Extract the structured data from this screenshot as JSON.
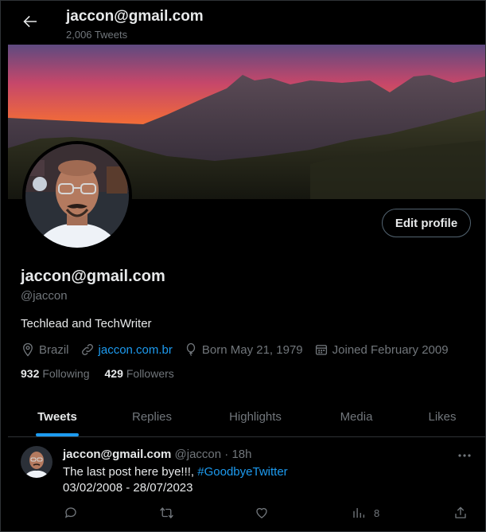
{
  "header": {
    "title": "jaccon@gmail.com",
    "tweet_count": "2,006 Tweets"
  },
  "profile": {
    "edit_label": "Edit profile",
    "name": "jaccon@gmail.com",
    "handle": "@jaccon",
    "bio": "Techlead and TechWriter",
    "location": "Brazil",
    "website": "jaccon.com.br",
    "born": "Born May 21, 1979",
    "joined": "Joined February 2009",
    "following_count": "932",
    "following_label": "Following",
    "followers_count": "429",
    "followers_label": "Followers"
  },
  "tabs": [
    {
      "label": "Tweets",
      "active": true
    },
    {
      "label": "Replies",
      "active": false
    },
    {
      "label": "Highlights",
      "active": false
    },
    {
      "label": "Media",
      "active": false
    },
    {
      "label": "Likes",
      "active": false
    }
  ],
  "tweet": {
    "name": "jaccon@gmail.com",
    "handle": "@jaccon",
    "separator": "·",
    "time": "18h",
    "text": "The last post here bye!!!, ",
    "hashtag": "#GoodbyeTwitter",
    "line2": "03/02/2008 - 28/07/2023",
    "views": "8"
  },
  "colors": {
    "background": "#000000",
    "accent": "#1d9bf0",
    "primary_text": "#e7e9ea",
    "secondary_text": "#71767b"
  },
  "icons": [
    "arrow-left-icon",
    "location-icon",
    "link-icon",
    "balloon-icon",
    "calendar-icon",
    "more-icon",
    "reply-icon",
    "retweet-icon",
    "like-icon",
    "views-icon",
    "share-icon"
  ]
}
